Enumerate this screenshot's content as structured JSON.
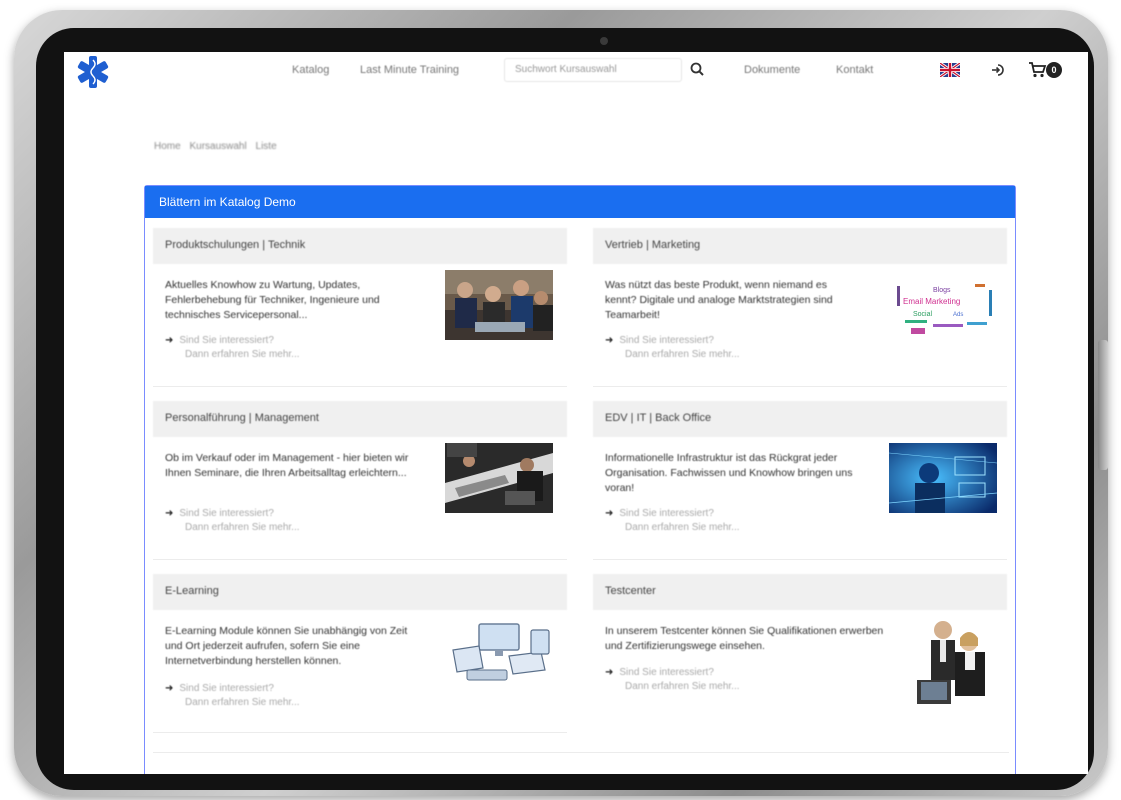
{
  "nav": {
    "links": [
      "Katalog",
      "Last Minute Training"
    ],
    "search_placeholder": "Suchwort Kursauswahl",
    "right_links": [
      "Dokumente",
      "Kontakt"
    ],
    "cart_count": "0"
  },
  "breadcrumb": [
    "Home",
    "Kursauswahl",
    "Liste"
  ],
  "panel": {
    "heading": "Blättern im Katalog Demo"
  },
  "cards": [
    {
      "title": "Produktschulungen | Technik",
      "text": "Aktuelles Knowhow zu Wartung, Updates, Fehlerbehebung für Techniker, Ingenieure und technisches Servicepersonal...",
      "more": "Sind Sie interessiert?",
      "more_sub": "Dann erfahren Sie mehr..."
    },
    {
      "title": "Vertrieb | Marketing",
      "text": "Was nützt das beste Produkt, wenn niemand es kennt? Digitale und analoge Marktstrategien sind Teamarbeit!",
      "more": "Sind Sie interessiert?",
      "more_sub": "Dann erfahren Sie mehr..."
    },
    {
      "title": "Personalführung | Management",
      "text": "Ob im Verkauf oder im Management - hier bieten wir Ihnen Seminare, die Ihren Arbeitsalltag erleichtern...",
      "more": "Sind Sie interessiert?",
      "more_sub": "Dann erfahren Sie mehr..."
    },
    {
      "title": "EDV | IT | Back Office",
      "text": "Informationelle Infrastruktur ist das Rückgrat jeder Organisation. Fachwissen und Knowhow bringen uns voran!",
      "more": "Sind Sie interessiert?",
      "more_sub": "Dann erfahren Sie mehr..."
    },
    {
      "title": "E-Learning",
      "text": "E-Learning Module können Sie unabhängig von Zeit und Ort jederzeit aufrufen, sofern Sie eine Internetverbindung herstellen können.",
      "more": "Sind Sie interessiert?",
      "more_sub": "Dann erfahren Sie mehr..."
    },
    {
      "title": "Testcenter",
      "text": "In unserem Testcenter können Sie Qualifikationen erwerben und Zertifizierungswege einsehen.",
      "more": "Sind Sie interessiert?",
      "more_sub": "Dann erfahren Sie mehr..."
    }
  ],
  "word_cloud": [
    "Email Marketing",
    "Blogs",
    "Social",
    "Ads"
  ],
  "colors": {
    "panel_heading_bg": "#1a6ef0",
    "panel_border": "#7a8cff",
    "card_title_bg": "#f0f0f0",
    "logo": "#1f5fd1"
  }
}
